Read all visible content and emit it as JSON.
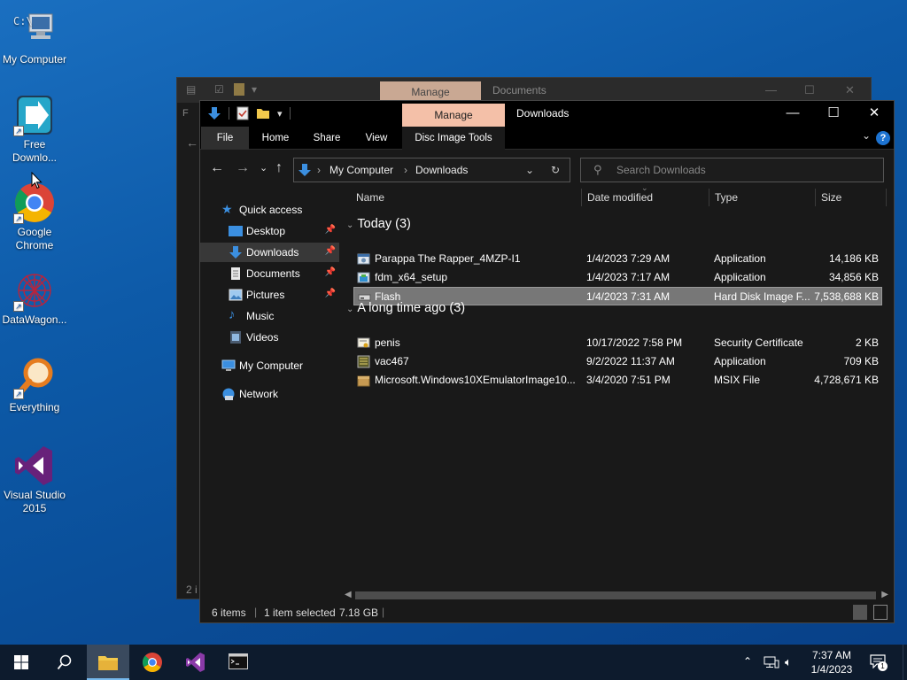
{
  "desktop": {
    "icons": [
      {
        "label": "My Computer"
      },
      {
        "label": "Free Downlo..."
      },
      {
        "label": "Google Chrome"
      },
      {
        "label": "DataWagon..."
      },
      {
        "label": "Everything"
      },
      {
        "label": "Visual Studio 2015"
      }
    ]
  },
  "back_window": {
    "manage_label": "Manage",
    "title": "Documents",
    "status_fragment": "2 i"
  },
  "window": {
    "manage_label": "Manage",
    "title": "Downloads",
    "ribbon_tabs": {
      "file": "File",
      "home": "Home",
      "share": "Share",
      "view": "View",
      "disc": "Disc Image Tools"
    },
    "address": {
      "crumb1": "My Computer",
      "crumb2": "Downloads"
    },
    "search_placeholder": "Search Downloads",
    "nav": {
      "quick_access": "Quick access",
      "desktop": "Desktop",
      "downloads": "Downloads",
      "documents": "Documents",
      "pictures": "Pictures",
      "music": "Music",
      "videos": "Videos",
      "my_computer": "My Computer",
      "network": "Network"
    },
    "columns": {
      "name": "Name",
      "date": "Date modified",
      "type": "Type",
      "size": "Size"
    },
    "groups": [
      {
        "label": "Today (3)",
        "files": [
          {
            "name": "Parappa The Rapper_4MZP-I1",
            "date": "1/4/2023 7:29 AM",
            "type": "Application",
            "size": "14,186 KB",
            "icon": "application-icon"
          },
          {
            "name": "fdm_x64_setup",
            "date": "1/4/2023 7:17 AM",
            "type": "Application",
            "size": "34,856 KB",
            "icon": "installer-icon"
          },
          {
            "name": "Flash",
            "date": "1/4/2023 7:31 AM",
            "type": "Hard Disk Image F...",
            "size": "7,538,688 KB",
            "icon": "disk-image-icon"
          }
        ]
      },
      {
        "label": "A long time ago (3)",
        "files": [
          {
            "name": "penis",
            "date": "10/17/2022 7:58 PM",
            "type": "Security Certificate",
            "size": "2 KB",
            "icon": "certificate-icon"
          },
          {
            "name": "vac467",
            "date": "9/2/2022 11:37 AM",
            "type": "Application",
            "size": "709 KB",
            "icon": "application-icon"
          },
          {
            "name": "Microsoft.Windows10XEmulatorImage10...",
            "date": "3/4/2020 7:51 PM",
            "type": "MSIX File",
            "size": "4,728,671 KB",
            "icon": "package-icon"
          }
        ]
      }
    ],
    "status": {
      "items": "6 items",
      "selected": "1 item selected",
      "selected_size": "7.18 GB"
    }
  },
  "taskbar": {
    "clock_time": "7:37 AM",
    "clock_date": "1/4/2023",
    "notification_count": "1"
  },
  "colors": {
    "manage_accent": "#f4c0a8",
    "selection": "#777777",
    "desktop_blue": "#0d5aa8",
    "taskbar": "#0d1b2d"
  }
}
